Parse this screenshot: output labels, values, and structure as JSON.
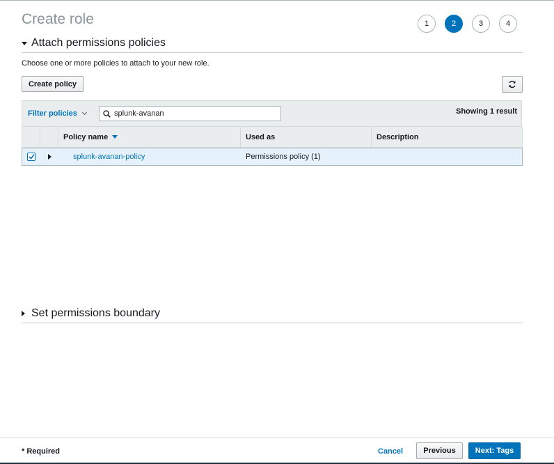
{
  "page": {
    "title": "Create role"
  },
  "steps": [
    {
      "label": "1",
      "active": false
    },
    {
      "label": "2",
      "active": true
    },
    {
      "label": "3",
      "active": false
    },
    {
      "label": "4",
      "active": false
    }
  ],
  "attach_section": {
    "title": "Attach permissions policies",
    "description": "Choose one or more policies to attach to your new role.",
    "create_policy_label": "Create policy",
    "refresh_icon": "refresh-icon"
  },
  "filter": {
    "label": "Filter policies",
    "search_value": "splunk-avanan",
    "showing": "Showing 1 result"
  },
  "table": {
    "columns": [
      "Policy name",
      "Used as",
      "Description"
    ],
    "rows": [
      {
        "checked": true,
        "name": "splunk-avanan-policy",
        "used_as": "Permissions policy (1)",
        "description": ""
      }
    ]
  },
  "boundary_section": {
    "title": "Set permissions boundary"
  },
  "footer": {
    "required": "* Required",
    "cancel": "Cancel",
    "previous": "Previous",
    "next": "Next: Tags"
  },
  "colors": {
    "accent": "#0073bb",
    "selected_row": "#e6f2fb",
    "header_bg": "#eaeded"
  }
}
